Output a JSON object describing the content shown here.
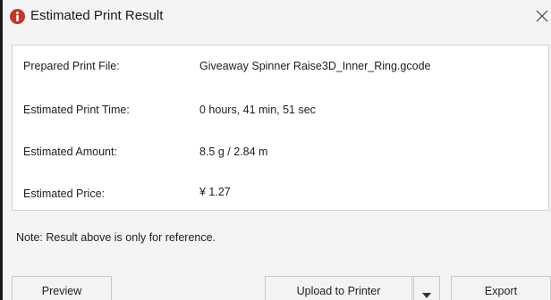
{
  "window": {
    "title": "Estimated Print Result",
    "accent_color": "#c0392b"
  },
  "result": {
    "rows": [
      {
        "label": "Prepared Print File:",
        "value": "Giveaway Spinner Raise3D_Inner_Ring.gcode"
      },
      {
        "label": "Estimated Print Time:",
        "value": "0 hours, 41 min, 51 sec"
      },
      {
        "label": "Estimated Amount:",
        "value": "8.5 g / 2.84 m"
      },
      {
        "label": "Estimated Price:",
        "value": "¥ 1.27"
      }
    ]
  },
  "note": "Note: Result above is only for reference.",
  "buttons": {
    "preview": "Preview",
    "upload": "Upload to Printer",
    "export": "Export"
  },
  "icons": {
    "title": "info-icon",
    "close": "close-icon",
    "dropdown": "chevron-down-icon"
  }
}
